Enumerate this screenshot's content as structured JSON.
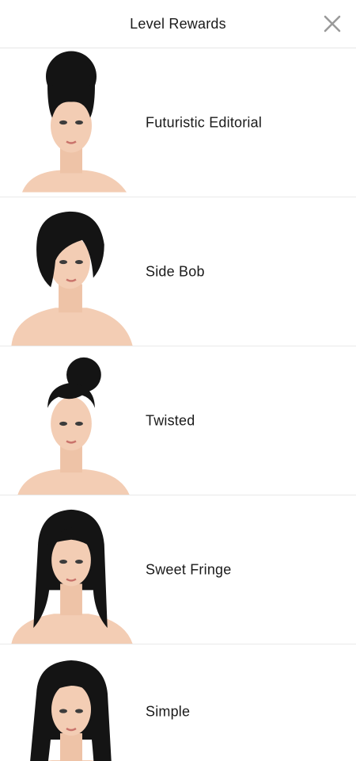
{
  "header": {
    "title": "Level Rewards",
    "close_icon": "close-icon"
  },
  "rewards": [
    {
      "label": "Futuristic Editorial",
      "hair": "bun-top"
    },
    {
      "label": "Side Bob",
      "hair": "side-bob"
    },
    {
      "label": "Twisted",
      "hair": "twisted-bun"
    },
    {
      "label": "Sweet Fringe",
      "hair": "long-fringe"
    },
    {
      "label": "Simple",
      "hair": "long-straight"
    }
  ],
  "colors": {
    "skin": "#f3cdb4",
    "hair": "#141414",
    "divider": "#e9e9e9",
    "text": "#1a1a1a"
  }
}
